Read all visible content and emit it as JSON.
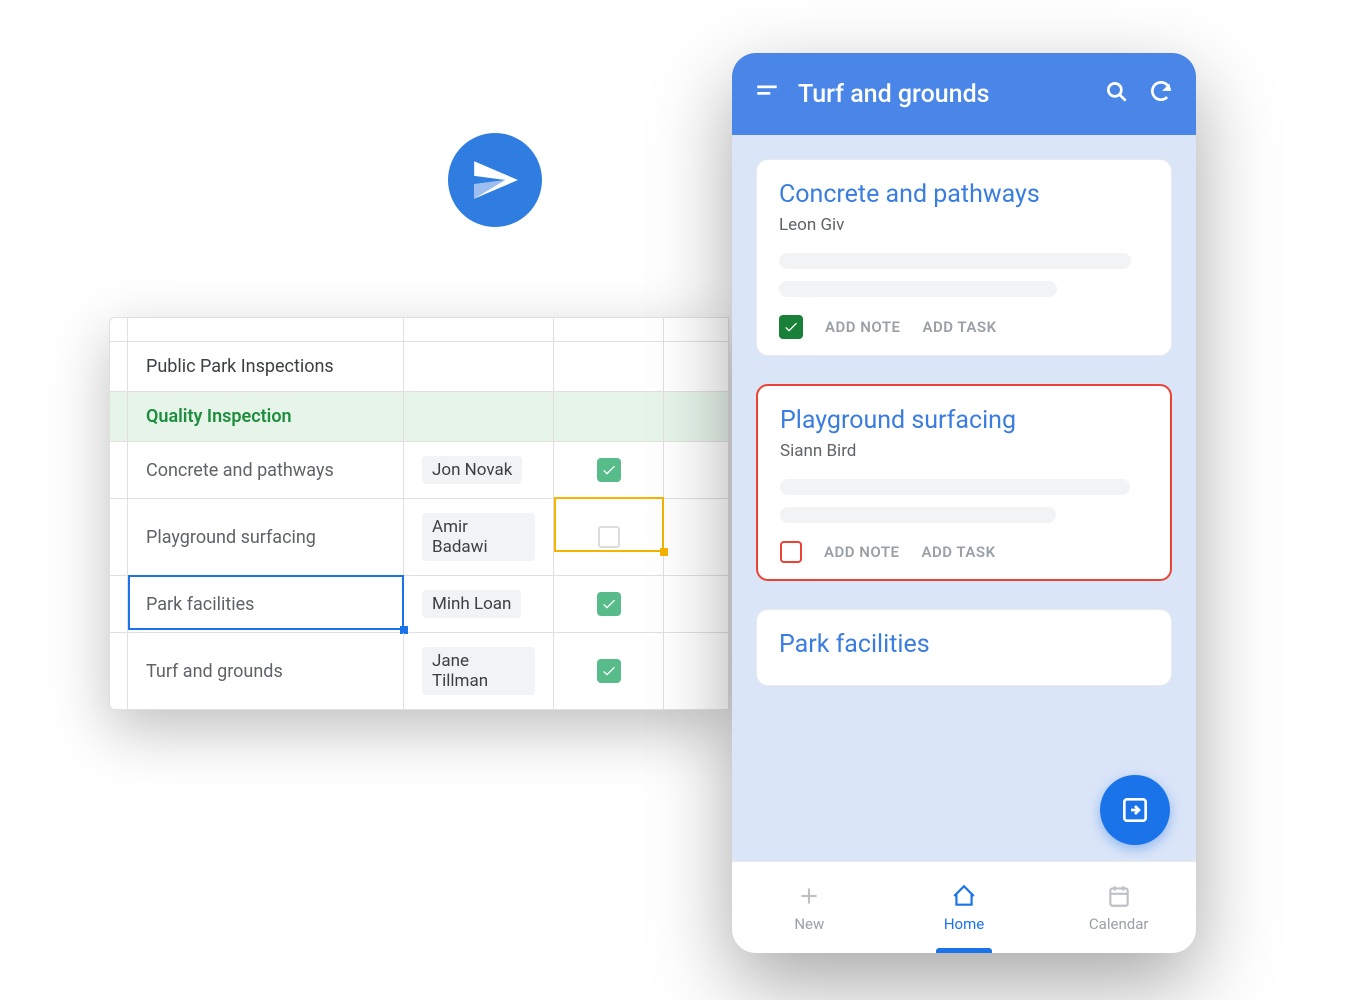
{
  "spreadsheet": {
    "title": "Public Park Inspections",
    "section": "Quality Inspection",
    "rows": [
      {
        "item": "Concrete and pathways",
        "person": "Jon Novak",
        "checked": true
      },
      {
        "item": "Playground surfacing",
        "person": "Amir Badawi",
        "checked": false
      },
      {
        "item": "Park facilities",
        "person": "Minh Loan",
        "checked": true
      },
      {
        "item": "Turf and grounds",
        "person": "Jane Tillman",
        "checked": true
      }
    ]
  },
  "mobile": {
    "header_title": "Turf and grounds",
    "cards": [
      {
        "title": "Concrete and pathways",
        "sub": "Leon Giv",
        "add_note": "ADD NOTE",
        "add_task": "ADD TASK"
      },
      {
        "title": "Playground surfacing",
        "sub": "Siann Bird",
        "add_note": "ADD NOTE",
        "add_task": "ADD TASK"
      }
    ],
    "partial_card_title": "Park facilities",
    "nav": {
      "new": "New",
      "home": "Home",
      "calendar": "Calendar"
    }
  }
}
